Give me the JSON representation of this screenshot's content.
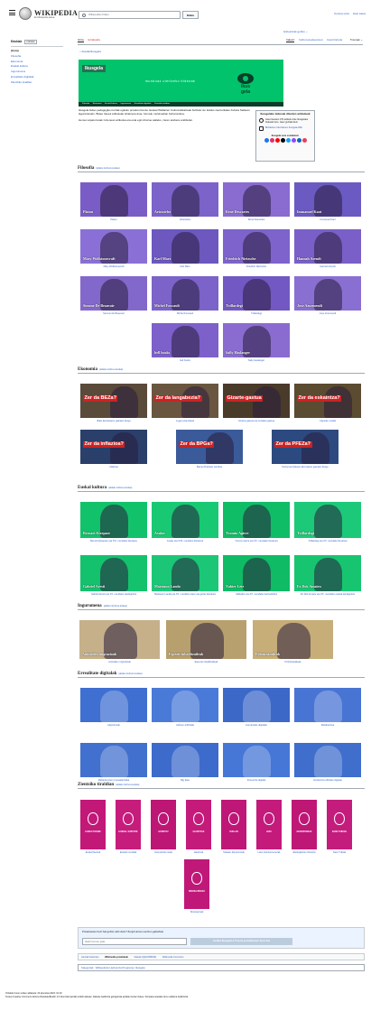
{
  "header": {
    "wordmark": "WIKIPEDIA",
    "tagline": "Entziklopedia askea",
    "search_placeholder": "Wikipedian bilatu",
    "search_button": "Bilatu",
    "links": [
      "Kontua sortu",
      "Hasi saioa"
    ]
  },
  "sidebar": {
    "heading": "Edukiak",
    "hide_label": "ezkutatu",
    "items": [
      "(Goia)",
      "Filosofia",
      "Ekonomia",
      "Euskal kultura",
      "Ingurumena",
      "Errealitate digitalak",
      "Zientziko tiraldian"
    ]
  },
  "lang_button": "Hizkuntzak gehitu",
  "tabs_left": [
    "Orria",
    "Eztabaida"
  ],
  "tabs_right": [
    "Irakurri",
    "Iturburu-kodea ikusi",
    "Ikusi historia",
    "Tresnak"
  ],
  "back_link": "< Atariak/Ikusgela",
  "banner": {
    "title": "Ikusgela",
    "slogan": "munduaz ulertzeko bideoak",
    "nav": [
      "Filosofia",
      "Ekonomia",
      "Euskal kultura",
      "Ingurumena",
      "Errealitate digitalak",
      "Zientziko tiraldian"
    ],
    "logo_text": "ikus gela"
  },
  "intro": {
    "p1": "Ikusgela bideo pedagogiko iturriak egiteko proiektu bat da. Euskal Wikilarien Kultura Elkarteak bultzatu du. Eduko zaurturikako Kultura Sailaren laguntzarekin. Bideo hauek artikuluak ohiatzena dute, formatu multimedian beharrezkoa.",
    "p2": "Hemen aipatu lanak zuzenean artikulua eta esta egin dituzue ataleko, zaren arabera erabiletan."
  },
  "infobox": {
    "title": "Ikusgelako bideoak dituzten artikuluak",
    "row1": "Gaur-hausten 370 artikulu dute Ikusgelako bideoak bere. Gaur guztiak ikusi",
    "row2": "Bisitatuko ordezkatuen Ikusgela-Wiki",
    "sub": "Ikusgela sare sozialetan:",
    "social_colors": [
      "#1877f2",
      "#e1306c",
      "#ff0000",
      "#000000",
      "#1da1f2",
      "#9146ff",
      "#0a66c2",
      "#e4405f"
    ]
  },
  "edit_label": "(aldatu iturburu-kodea)",
  "sections": {
    "filo": {
      "title": "Filosofia",
      "items": [
        {
          "thumb": "Platon",
          "cap": "Platon",
          "bg": "#7a5cc6"
        },
        {
          "thumb": "Aristoteles",
          "cap": "Aristoteles",
          "bg": "#7b63c9"
        },
        {
          "thumb": "René Descartes",
          "cap": "René Descartes",
          "bg": "#8a6bd0"
        },
        {
          "thumb": "Immanuel Kant",
          "cap": "Immanuel Kant",
          "bg": "#6b5ac2"
        },
        {
          "thumb": "Mary Wollstonecraft",
          "cap": "Mary Wollstonecraft",
          "bg": "#8a70d6"
        },
        {
          "thumb": "Karl Marx",
          "cap": "Karl Marx",
          "bg": "#6d58c0"
        },
        {
          "thumb": "Friedrich Nietzsche",
          "cap": "Friedrich Nietzsche",
          "bg": "#7d63cb"
        },
        {
          "thumb": "Hannah Arendt",
          "cap": "Hannah Arendt",
          "bg": "#7a5fc8"
        },
        {
          "thumb": "Simone De Beauvoir",
          "cap": "Simone De Beauvoir",
          "bg": "#8368cc"
        },
        {
          "thumb": "Michel Foucault",
          "cap": "Michel Foucault",
          "bg": "#7b63c9"
        },
        {
          "thumb": "Txillardegi",
          "cap": "Txillardegi",
          "bg": "#7258c3"
        },
        {
          "thumb": "Joxe Azurmendi",
          "cap": "Joxe Azurmendi",
          "bg": "#8a6fd2"
        },
        {
          "thumb": "bell hooks",
          "cap": "bell hooks",
          "bg": "#7d60ca"
        },
        {
          "thumb": "Sally Haslanger",
          "cap": "Sally Haslanger",
          "bg": "#8a6cd0"
        }
      ]
    },
    "eko": {
      "title": "Ekonomia",
      "items": [
        {
          "thumb": "Zer da BEZa?",
          "cap": "Balio Erantsiaren gaineko Zerga",
          "bg": "#5a4a3a"
        },
        {
          "thumb": "Zer da langabezia?",
          "cap": "Lugar piramideak",
          "bg": "#6a5640"
        },
        {
          "thumb": "Gizarte-gastua",
          "cap": "Gizarte-gastua eta sozialea gastua",
          "bg": "#4a3a2a"
        },
        {
          "thumb": "Zer da eskaintza?",
          "cap": "Capsule modak",
          "bg": "#5b4b30"
        },
        {
          "thumb": "Zer da inflazioa?",
          "cap": "Inflazioa",
          "bg": "#2a3f6a"
        },
        {
          "thumb": "Zer da BPGa?",
          "cap": "Barne Produktu Gordina",
          "bg": "#3b5a9a"
        },
        {
          "thumb": "Zer da PFEZa?",
          "cap": "Pertsona Fisikoen Errentaren gaineko Zerga",
          "bg": "#2d4a80"
        }
      ]
    },
    "euskal": {
      "title": "Euskal kultura",
      "items": [
        {
          "thumb": "Bernart Etxepare",
          "cap": "Bernart Etxepare eta XVI. mendeko literatura",
          "bg": "#12c26b"
        },
        {
          "thumb": "Axular",
          "cap": "Axular eta XVII. mendeko literatura",
          "bg": "#18c873"
        },
        {
          "thumb": "Txomin Agirre",
          "cap": "Txomin Agirre eta XX. mendeko literatura",
          "bg": "#10bd67"
        },
        {
          "thumb": "Txillardegi",
          "cap": "Txillardegi eta XX. mendeko literatura",
          "bg": "#1cc978"
        },
        {
          "thumb": "Gabriel Aresti",
          "cap": "Gabriel Aresti eta XX. mendeko olerkigintza",
          "bg": "#14c26d"
        },
        {
          "thumb": "Mariasun Landa",
          "cap": "Mariasun Landa eta XX. mendeko Haur eta gazte literatura",
          "bg": "#1bc777"
        },
        {
          "thumb": "Xabier Lete",
          "cap": "Xalbador eta XX. mendeko bertsolaritza",
          "bg": "#0fbb65"
        },
        {
          "thumb": "Ez Dok Amairu",
          "cap": "Ez Dok Amairu eta XX. mendeko euskal kantagintza",
          "bg": "#17c571"
        }
      ]
    },
    "ingu": {
      "title": "Ingurumena",
      "items": [
        {
          "thumb": "Animalien migrazioak",
          "cap": "Animalien migrazioak",
          "bg": "#c5b08a"
        },
        {
          "thumb": "Espezie inbaditzaileak",
          "cap": "Espezie inbaditzaileak",
          "bg": "#b8a06e"
        },
        {
          "thumb": "Polinizatzaileak",
          "cap": "Polinizatzaileak",
          "bg": "#c7ad78"
        }
      ]
    },
    "erre": {
      "title": "Errealitate digitalak",
      "items": [
        {
          "cap": "Algoritmoak",
          "bg": "#3f6fd0"
        },
        {
          "cap": "Adimen artifiziala",
          "bg": "#4a7ad8"
        },
        {
          "cap": "Humanitate digitalak",
          "bg": "#3c68c8"
        },
        {
          "cap": "Metabertsoa",
          "bg": "#4875d4"
        },
        {
          "cap": "Mekanismoen pmesaderizaka",
          "bg": "#4270ce"
        },
        {
          "cap": "Big data",
          "bg": "#3d6bcb"
        },
        {
          "cap": "Kirtsuntza digitala",
          "bg": "#4676d6"
        },
        {
          "cap": "Hezkuntza ofizialen digitala",
          "bg": "#3f6ecd"
        }
      ]
    },
    "zien": {
      "title": "Zientziko tiraldian",
      "items": [
        {
          "thumb": "EUSKO TEKNIK",
          "cap": "Euskal faerrak",
          "bg": "#c21878"
        },
        {
          "thumb": "EUSKAL SUSTATIK",
          "cap": "Euskal mendiak",
          "bg": "#c61c7c"
        },
        {
          "thumb": "GORPUTZ",
          "cap": "Gorputzeko rieak",
          "bg": "#bd1675"
        },
        {
          "thumb": "HAURTZAK",
          "cap": "Haurtzak",
          "bg": "#c41b7a"
        },
        {
          "thumb": "SUKLAN",
          "cap": "Sukaan dipneumoak",
          "bg": "#bf1777"
        },
        {
          "thumb": "LEKU",
          "cap": "Leku iraunkumenerak",
          "bg": "#c31a7b"
        },
        {
          "thumb": "EKOSISTEMAK",
          "cap": "Ekologikaren Zientzia",
          "bg": "#be1776"
        },
        {
          "thumb": "SARE TXIKIAK",
          "cap": "Sare Txikiak",
          "bg": "#c41c7c"
        },
        {
          "thumb": "DINOSAURIOAK",
          "cap": "Dinosauroak",
          "bg": "#c01878"
        }
      ]
    }
  },
  "feedback": {
    "question": "Proiektuaren berri bat gehitu nahi duzu? Zergit Hemen sortzen gaituzkek",
    "input_placeholder": "Idatzi hemen gaia",
    "button": "Gehitu Ikusgela-k Tresna proiektuaren berri bat"
  },
  "meta": [
    "Jauziak hasieratu",
    "Wikimedia proiektuak",
    "Datuak (Q110096630)",
    "Wikimedia Commons"
  ],
  "categories": "Kategoriak : Wikipedioko Hezkuntza Programa | Ikusgela",
  "footer": {
    "line1": "Orrialde honen azken aldaketa: 24 abendua 2023, 10:19",
    "line2": "Testua Creative Commons Aitortu-PartekatuBerdin 4.0 lizentziari jarraiki erabili daiteke; baliteke baldintza gehigarriak aplikatu behar izatea. Xehetasunetarako ikus erabilera baldintzak."
  }
}
